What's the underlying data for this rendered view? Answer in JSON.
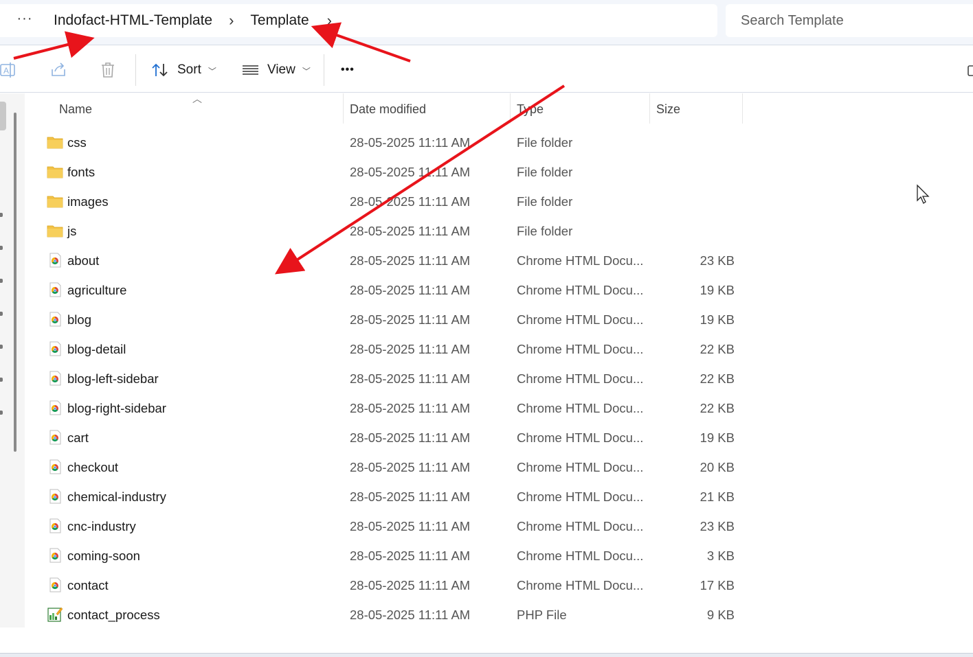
{
  "breadcrumb": {
    "more_label": "···",
    "items": [
      "Indofact-HTML-Template",
      "Template"
    ]
  },
  "search": {
    "placeholder": "Search Template"
  },
  "toolbar": {
    "sort_label": "Sort",
    "view_label": "View",
    "more_label": "•••"
  },
  "columns": {
    "name": "Name",
    "date": "Date modified",
    "type": "Type",
    "size": "Size"
  },
  "files": [
    {
      "name": "css",
      "date": "28-05-2025 11:11 AM",
      "type": "File folder",
      "size": "",
      "icon": "folder-icon"
    },
    {
      "name": "fonts",
      "date": "28-05-2025 11:11 AM",
      "type": "File folder",
      "size": "",
      "icon": "folder-icon"
    },
    {
      "name": "images",
      "date": "28-05-2025 11:11 AM",
      "type": "File folder",
      "size": "",
      "icon": "folder-icon"
    },
    {
      "name": "js",
      "date": "28-05-2025 11:11 AM",
      "type": "File folder",
      "size": "",
      "icon": "folder-icon"
    },
    {
      "name": "about",
      "date": "28-05-2025 11:11 AM",
      "type": "Chrome HTML Docu...",
      "size": "23 KB",
      "icon": "chrome-html-icon"
    },
    {
      "name": "agriculture",
      "date": "28-05-2025 11:11 AM",
      "type": "Chrome HTML Docu...",
      "size": "19 KB",
      "icon": "chrome-html-icon"
    },
    {
      "name": "blog",
      "date": "28-05-2025 11:11 AM",
      "type": "Chrome HTML Docu...",
      "size": "19 KB",
      "icon": "chrome-html-icon"
    },
    {
      "name": "blog-detail",
      "date": "28-05-2025 11:11 AM",
      "type": "Chrome HTML Docu...",
      "size": "22 KB",
      "icon": "chrome-html-icon"
    },
    {
      "name": "blog-left-sidebar",
      "date": "28-05-2025 11:11 AM",
      "type": "Chrome HTML Docu...",
      "size": "22 KB",
      "icon": "chrome-html-icon"
    },
    {
      "name": "blog-right-sidebar",
      "date": "28-05-2025 11:11 AM",
      "type": "Chrome HTML Docu...",
      "size": "22 KB",
      "icon": "chrome-html-icon"
    },
    {
      "name": "cart",
      "date": "28-05-2025 11:11 AM",
      "type": "Chrome HTML Docu...",
      "size": "19 KB",
      "icon": "chrome-html-icon"
    },
    {
      "name": "checkout",
      "date": "28-05-2025 11:11 AM",
      "type": "Chrome HTML Docu...",
      "size": "20 KB",
      "icon": "chrome-html-icon"
    },
    {
      "name": "chemical-industry",
      "date": "28-05-2025 11:11 AM",
      "type": "Chrome HTML Docu...",
      "size": "21 KB",
      "icon": "chrome-html-icon"
    },
    {
      "name": "cnc-industry",
      "date": "28-05-2025 11:11 AM",
      "type": "Chrome HTML Docu...",
      "size": "23 KB",
      "icon": "chrome-html-icon"
    },
    {
      "name": "coming-soon",
      "date": "28-05-2025 11:11 AM",
      "type": "Chrome HTML Docu...",
      "size": "3 KB",
      "icon": "chrome-html-icon"
    },
    {
      "name": "contact",
      "date": "28-05-2025 11:11 AM",
      "type": "Chrome HTML Docu...",
      "size": "17 KB",
      "icon": "chrome-html-icon"
    },
    {
      "name": "contact_process",
      "date": "28-05-2025 11:11 AM",
      "type": "PHP File",
      "size": "9 KB",
      "icon": "php-file-icon"
    }
  ],
  "colors": {
    "annotation_arrow": "#e8141b",
    "folder": "#f3c246",
    "accent": "#1f6fd1"
  }
}
